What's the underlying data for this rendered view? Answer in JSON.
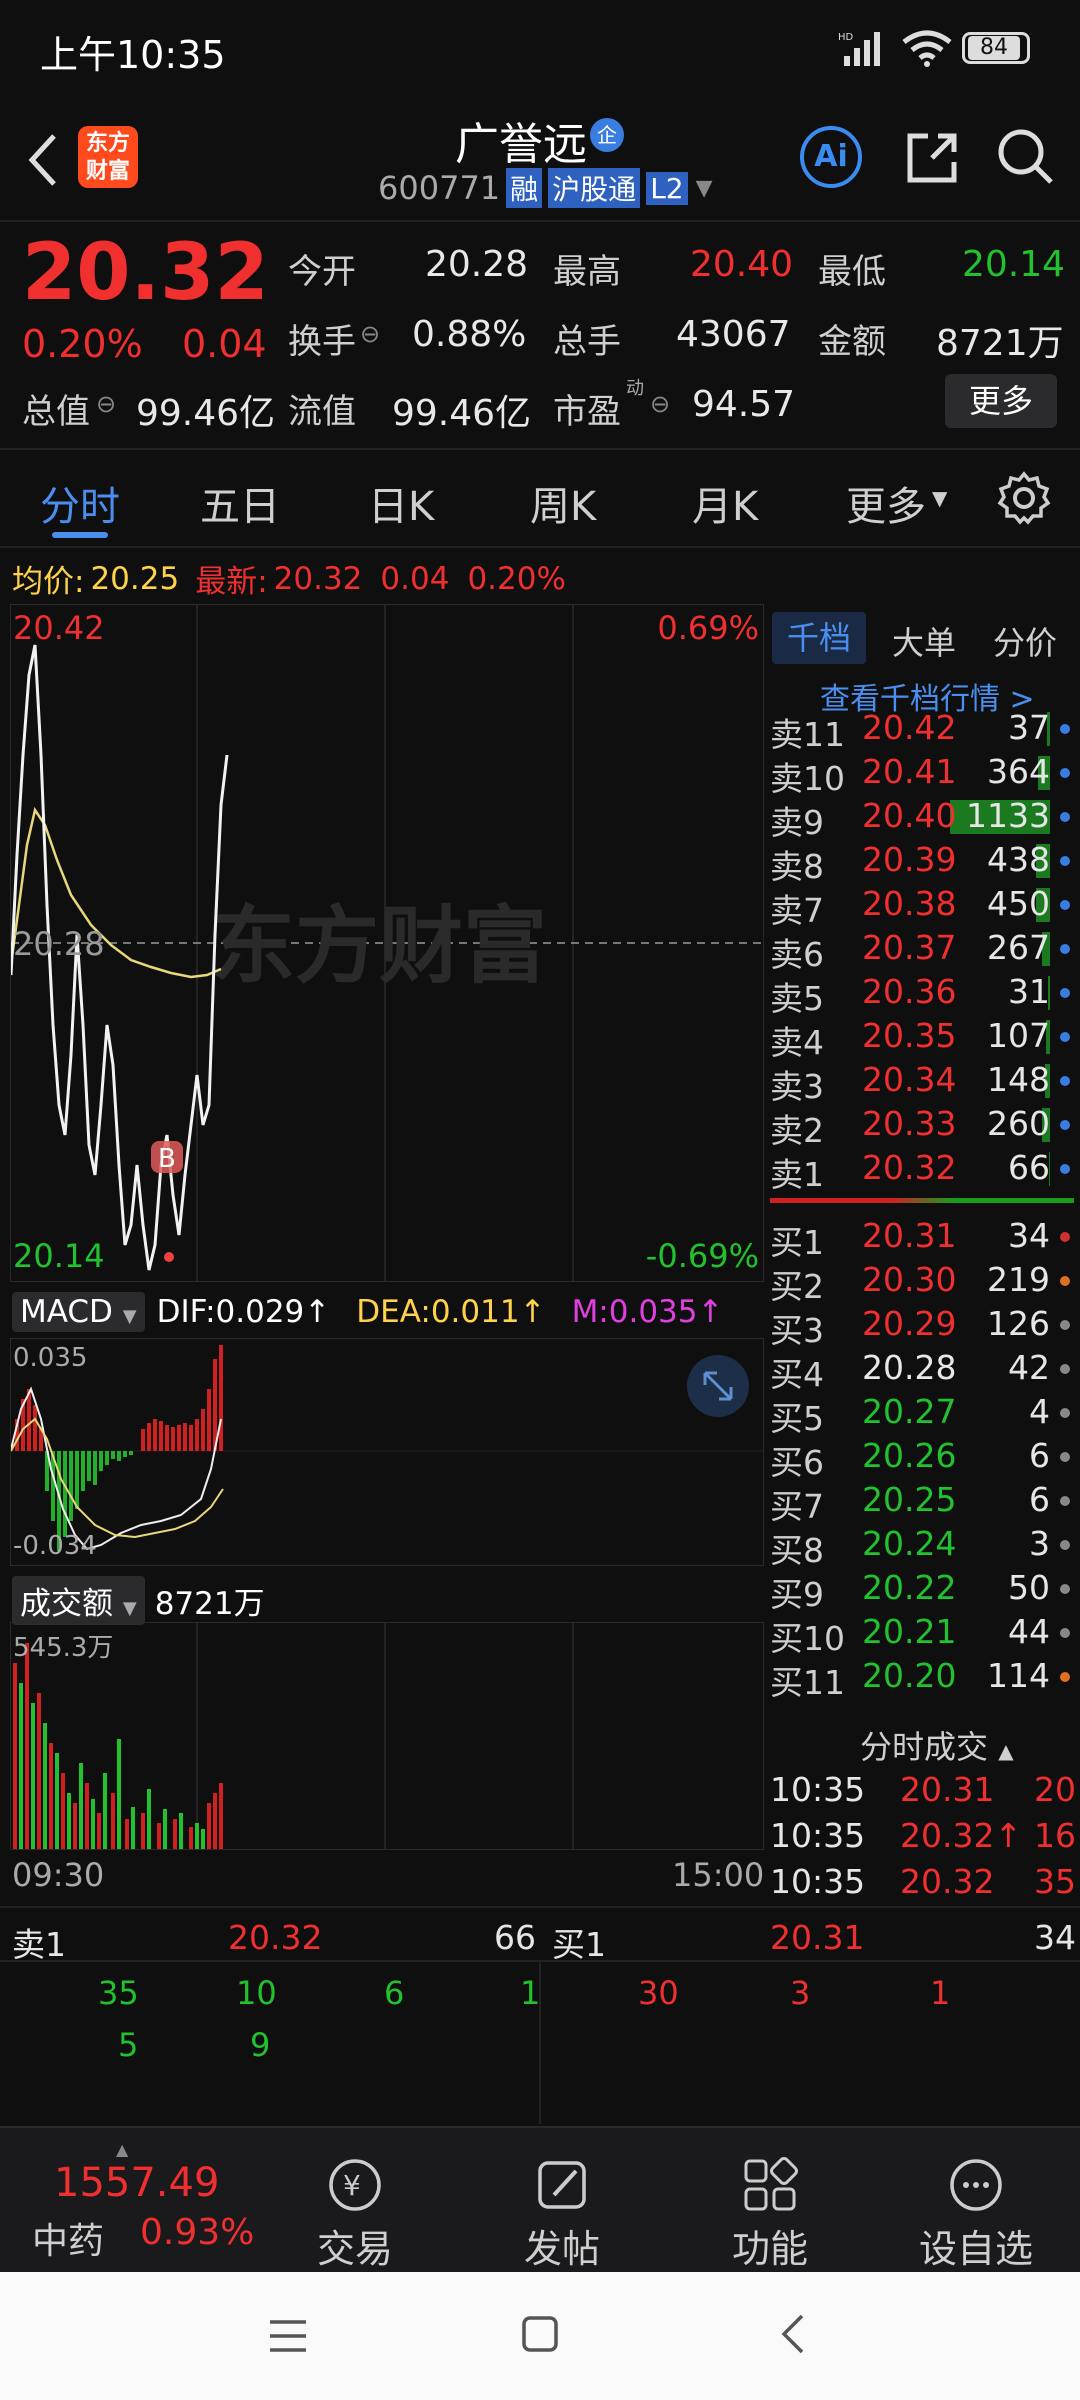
{
  "status": {
    "time": "上午10:35",
    "battery": "84"
  },
  "header": {
    "logo_line1": "东方",
    "logo_line2": "财富",
    "name": "广誉远",
    "badge": "企",
    "code": "600771",
    "tags": [
      "融",
      "沪股通",
      "L2"
    ],
    "ai": "Ai"
  },
  "quote": {
    "price": "20.32",
    "pct": "0.20%",
    "chg": "0.04",
    "open_label": "今开",
    "open": "20.28",
    "high_label": "最高",
    "high": "20.40",
    "low_label": "最低",
    "low": "20.14",
    "turnover_label": "换手",
    "turnover": "0.88%",
    "volume_label": "总手",
    "volume": "43067",
    "amount_label": "金额",
    "amount": "8721万",
    "mcap_label": "总值",
    "mcap": "99.46亿",
    "float_label": "流值",
    "float": "99.46亿",
    "pe_label": "市盈",
    "pe_super": "动",
    "pe": "94.57",
    "more": "更多"
  },
  "tabs": [
    "分时",
    "五日",
    "日K",
    "周K",
    "月K",
    "更多"
  ],
  "intraday": {
    "avg_label": "均价:",
    "avg": "20.25",
    "latest_label": "最新:",
    "latest": "20.32",
    "chg": "0.04",
    "pct": "0.20%",
    "top_price": "20.42",
    "top_pct": "0.69%",
    "mid_price": "20.28",
    "bottom_price": "20.14",
    "bottom_pct": "-0.69%",
    "watermark": "东方财富",
    "marker": "B"
  },
  "macd": {
    "name": "MACD",
    "dif": "DIF:0.029",
    "dea": "DEA:0.011",
    "m": "M:0.035",
    "arrow": "↑",
    "top": "0.035",
    "bottom": "-0.034"
  },
  "volume_panel": {
    "name": "成交额",
    "value": "8721万",
    "max": "545.3万",
    "time_start": "09:30",
    "time_end": "15:00"
  },
  "orderbook": {
    "tabs": [
      "千档",
      "大单",
      "分价"
    ],
    "link": "查看千档行情 >",
    "sell": [
      {
        "label": "卖11",
        "price": "20.42",
        "vol": "37",
        "bar": 0.03
      },
      {
        "label": "卖10",
        "price": "20.41",
        "vol": "364",
        "bar": 0.12
      },
      {
        "label": "卖9",
        "price": "20.40",
        "vol": "1133",
        "bar": 1.0
      },
      {
        "label": "卖8",
        "price": "20.39",
        "vol": "438",
        "bar": 0.14
      },
      {
        "label": "卖7",
        "price": "20.38",
        "vol": "450",
        "bar": 0.14
      },
      {
        "label": "卖6",
        "price": "20.37",
        "vol": "267",
        "bar": 0.08
      },
      {
        "label": "卖5",
        "price": "20.36",
        "vol": "31",
        "bar": 0.02
      },
      {
        "label": "卖4",
        "price": "20.35",
        "vol": "107",
        "bar": 0.04
      },
      {
        "label": "卖3",
        "price": "20.34",
        "vol": "148",
        "bar": 0.05
      },
      {
        "label": "卖2",
        "price": "20.33",
        "vol": "260",
        "bar": 0.08
      },
      {
        "label": "卖1",
        "price": "20.32",
        "vol": "66",
        "bar": 0.01
      }
    ],
    "buy": [
      {
        "label": "买1",
        "price": "20.31",
        "vol": "34"
      },
      {
        "label": "买2",
        "price": "20.30",
        "vol": "219"
      },
      {
        "label": "买3",
        "price": "20.29",
        "vol": "126"
      },
      {
        "label": "买4",
        "price": "20.28",
        "vol": "42"
      },
      {
        "label": "买5",
        "price": "20.27",
        "vol": "4"
      },
      {
        "label": "买6",
        "price": "20.26",
        "vol": "6"
      },
      {
        "label": "买7",
        "price": "20.25",
        "vol": "6"
      },
      {
        "label": "买8",
        "price": "20.24",
        "vol": "3"
      },
      {
        "label": "买9",
        "price": "20.22",
        "vol": "50"
      },
      {
        "label": "买10",
        "price": "20.21",
        "vol": "44"
      },
      {
        "label": "买11",
        "price": "20.20",
        "vol": "114"
      }
    ],
    "trades_title": "分时成交",
    "trades": [
      {
        "time": "10:35",
        "price": "20.31",
        "vol": "20"
      },
      {
        "time": "10:35",
        "price": "20.32↑",
        "vol": "16"
      },
      {
        "time": "10:35",
        "price": "20.32",
        "vol": "35"
      }
    ]
  },
  "queue": {
    "sell_label": "卖1",
    "sell_price": "20.32",
    "sell_vol": "66",
    "buy_label": "买1",
    "buy_price": "20.31",
    "buy_vol": "34",
    "sell_row1": [
      "35",
      "10",
      "6",
      "1"
    ],
    "sell_row2": [
      "5",
      "9"
    ],
    "buy_row1": [
      "30",
      "3",
      "1"
    ]
  },
  "bottom_nav": {
    "index_value": "1557.49",
    "index_name": "中药",
    "index_pct": "0.93%",
    "items": [
      "交易",
      "发帖",
      "功能",
      "设自选"
    ]
  }
}
